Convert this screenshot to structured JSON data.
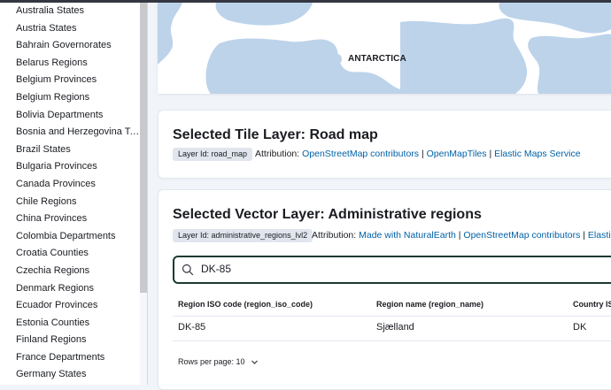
{
  "sidebar": {
    "items": [
      "Australia States",
      "Austria States",
      "Bahrain Governorates",
      "Belarus Regions",
      "Belgium Provinces",
      "Belgium Regions",
      "Bolivia Departments",
      "Bosnia and Herzegovina Terr...",
      "Brazil States",
      "Bulgaria Provinces",
      "Canada Provinces",
      "Chile Regions",
      "China Provinces",
      "Colombia Departments",
      "Croatia Counties",
      "Czechia Regions",
      "Denmark Regions",
      "Ecuador Provinces",
      "Estonia Counties",
      "Finland Regions",
      "France Departments",
      "Germany States"
    ]
  },
  "map": {
    "label": "ANTARCTICA",
    "land_color": "#bcd3ea"
  },
  "tile_layer": {
    "title": "Selected Tile Layer: Road map",
    "badge": "Layer Id: road_map",
    "attribution_label": "Attribution:",
    "links": [
      "OpenStreetMap contributors",
      "OpenMapTiles",
      "Elastic Maps Service"
    ]
  },
  "vector_layer": {
    "title": "Selected Vector Layer: Administrative regions",
    "badge": "Layer Id: administrative_regions_lvl2",
    "attribution_label": "Attribution:",
    "links": [
      "Made with NaturalEarth",
      "OpenStreetMap contributors",
      "Elastic Ma"
    ],
    "search": {
      "value": "DK-85"
    },
    "table": {
      "headers": [
        "Region ISO code (region_iso_code)",
        "Region name (region_name)",
        "Country ISO"
      ],
      "rows": [
        [
          "DK-85",
          "Sjælland",
          "DK"
        ]
      ]
    },
    "rows_per_page": "Rows per page: 10"
  },
  "colors": {
    "link": "#0061a6",
    "search_border": "#1c3a33",
    "badge_bg": "#e0e5ee"
  }
}
